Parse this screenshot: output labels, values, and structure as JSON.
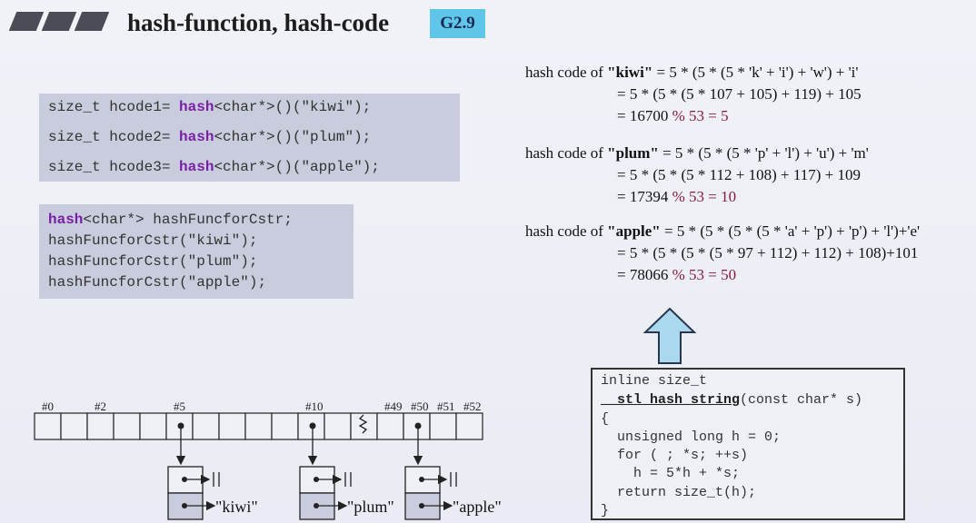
{
  "slide": {
    "title": "hash-function, hash-code",
    "badge": "G2.9"
  },
  "code_block_1": {
    "lines": [
      {
        "prefix": "size_t hcode1= ",
        "kw": "hash",
        "suffix": "<char*>()(\"kiwi\");"
      },
      {
        "prefix": "size_t hcode2= ",
        "kw": "hash",
        "suffix": "<char*>()(\"plum\");"
      },
      {
        "prefix": "size_t hcode3= ",
        "kw": "hash",
        "suffix": "<char*>()(\"apple\");"
      }
    ]
  },
  "code_block_2": {
    "line1_kw": "hash",
    "line1_rest": "<char*> hashFuncforCstr;",
    "line2": "hashFuncforCstr(\"kiwi\");",
    "line3": "hashFuncforCstr(\"plum\");",
    "line4": "hashFuncforCstr(\"apple\");"
  },
  "calculations": {
    "kiwi": {
      "prefix": "hash code of ",
      "word": "\"kiwi\"",
      "line1_rest": " = 5 * (5 * (5 * 'k' + 'i') + 'w') + 'i'",
      "line2": "= 5 * (5 * (5 * 107 + 105) + 119) + 105",
      "line3_val": "= 16700",
      "line3_mod": "% 53 = 5"
    },
    "plum": {
      "prefix": "hash code of ",
      "word": "\"plum\"",
      "line1_rest": " = 5 * (5 * (5 * 'p' + 'l') + 'u') + 'm'",
      "line2": "= 5 * (5 * (5 * 112 + 108) + 117) + 109",
      "line3_val": "=  17394",
      "line3_mod": "% 53 = 10"
    },
    "apple": {
      "prefix": "hash code of ",
      "word": "\"apple\"",
      "line1_rest": " = 5 * (5 * (5 * (5 * 'a' + 'p') + 'p') + 'l')+'e'",
      "line2": "= 5 * (5 * (5 * (5 * 97 + 112) + 112) + 108)+101",
      "line3_val": "=  78066",
      "line3_mod": "% 53 = 50"
    }
  },
  "stl_code": {
    "l1": "inline size_t",
    "l2_fn": "__stl_hash_string",
    "l2_rest": "(const char* s)",
    "l3": "{",
    "l4": "  unsigned long h = 0;",
    "l5": "  for ( ; *s; ++s)",
    "l6": "    h = 5*h + *s;",
    "l7": "  return size_t(h);",
    "l8": "}"
  },
  "bucket_diagram": {
    "index_labels": [
      "#0",
      "#2",
      "#5",
      "#10",
      "#49",
      "#50",
      "#51",
      "#52"
    ],
    "strings": [
      "\"kiwi\"",
      "\"plum\"",
      "\"apple\""
    ]
  },
  "colors": {
    "keyword": "#7a1ea8",
    "badge": "#5fc6ea",
    "modulo": "#8b1a3c",
    "code_bg": "#c8ccdc",
    "arrow": "#a9d8ef"
  }
}
